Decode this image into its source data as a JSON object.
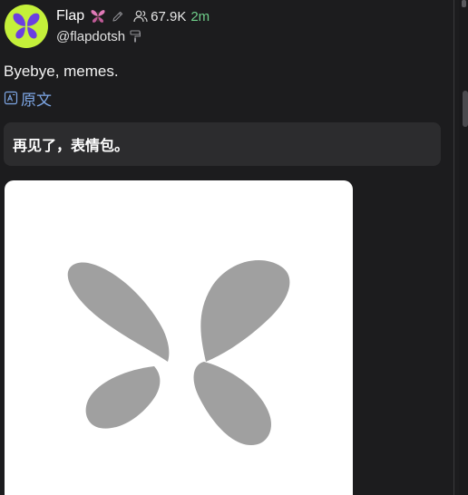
{
  "post": {
    "author_name": "Flap",
    "name_emoji_icon": "butterfly-emoji-icon",
    "edit_icon": "pencil-icon",
    "followers_icon": "users-icon",
    "followers_count": "67.9K",
    "time_ago": "2m",
    "handle": "@flapdotsh",
    "handle_badge_icon": "paint-roller-icon",
    "text": "Byebye, memes.",
    "source_link_label": "原文",
    "source_link_icon": "translate-icon",
    "translation": "再见了，表情包。",
    "media_alt_icon": "butterfly-logo-icon"
  },
  "colors": {
    "background": "#1c1c1e",
    "avatar_bg": "#c4f03a",
    "avatar_logo": "#6b3fe0",
    "time": "#6fcf8a",
    "link": "#7ea7e6",
    "translation_bg": "#2c2c2e",
    "media_bg": "#ffffff",
    "media_logo": "#a0a0a0"
  }
}
